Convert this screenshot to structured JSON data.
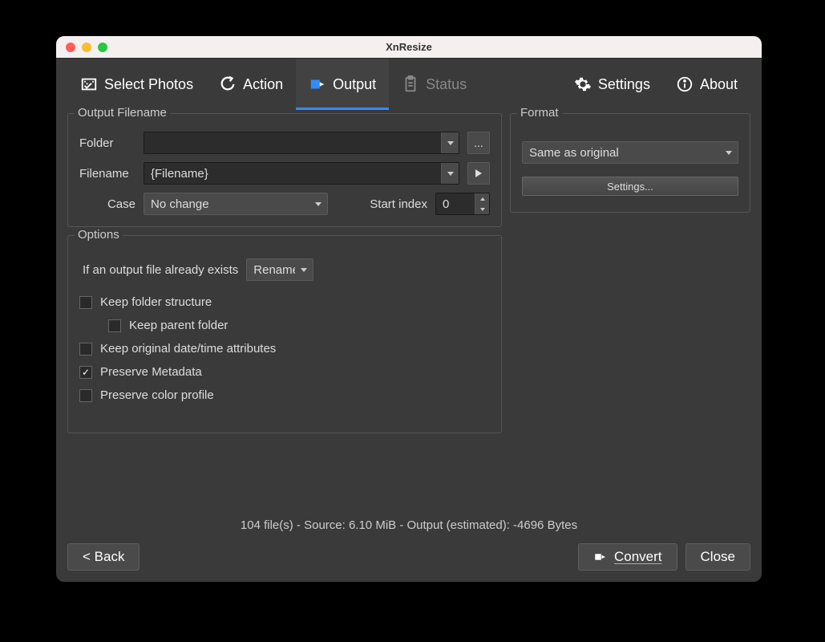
{
  "window": {
    "title": "XnResize"
  },
  "tabs": {
    "select_photos": "Select Photos",
    "action": "Action",
    "output": "Output",
    "status": "Status",
    "settings": "Settings",
    "about": "About"
  },
  "output_filename": {
    "group_title": "Output Filename",
    "folder_label": "Folder",
    "folder_value": "",
    "browse_button": "...",
    "filename_label": "Filename",
    "filename_value": "{Filename}",
    "case_label": "Case",
    "case_value": "No change",
    "start_index_label": "Start index",
    "start_index_value": "0"
  },
  "format": {
    "group_title": "Format",
    "selected": "Same as original",
    "settings_button": "Settings..."
  },
  "options": {
    "group_title": "Options",
    "exists_label": "If an output file already exists",
    "exists_value": "Rename",
    "keep_folder_structure": {
      "label": "Keep folder structure",
      "checked": false
    },
    "keep_parent_folder": {
      "label": "Keep parent folder",
      "checked": false
    },
    "keep_datetime": {
      "label": "Keep original date/time attributes",
      "checked": false
    },
    "preserve_metadata": {
      "label": "Preserve Metadata",
      "checked": true
    },
    "preserve_color_profile": {
      "label": "Preserve color profile",
      "checked": false
    }
  },
  "statusbar": "104 file(s) - Source: 6.10 MiB - Output (estimated): -4696 Bytes",
  "footer": {
    "back": "< Back",
    "convert": "Convert",
    "close": "Close"
  }
}
